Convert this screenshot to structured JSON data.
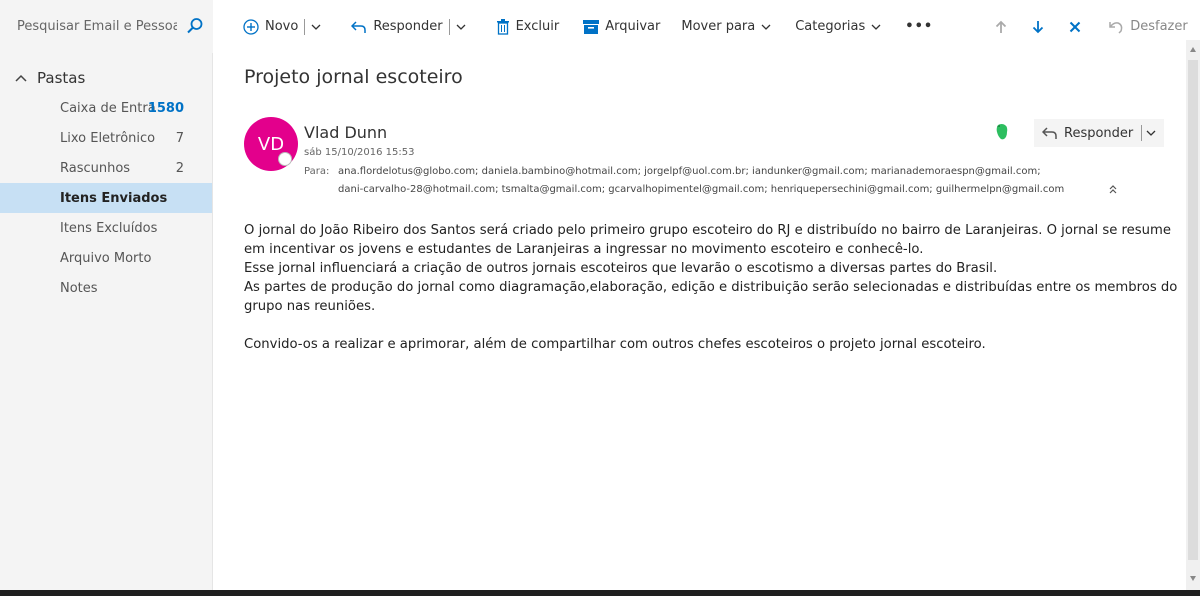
{
  "search": {
    "placeholder": "Pesquisar Email e Pessoas"
  },
  "toolbar": {
    "new_label": "Novo",
    "reply_label": "Responder",
    "delete_label": "Excluir",
    "archive_label": "Arquivar",
    "move_label": "Mover para",
    "categories_label": "Categorias",
    "more_label": "•••",
    "undo_label": "Desfazer"
  },
  "sidebar": {
    "header": "Pastas",
    "folders": [
      {
        "label": "Caixa de Entra",
        "count": "1580"
      },
      {
        "label": "Lixo Eletrônico",
        "count": "7"
      },
      {
        "label": "Rascunhos",
        "count": "2"
      },
      {
        "label": "Itens Enviados",
        "count": ""
      },
      {
        "label": "Itens Excluídos",
        "count": ""
      },
      {
        "label": "Arquivo Morto",
        "count": ""
      },
      {
        "label": "Notes",
        "count": ""
      }
    ]
  },
  "message": {
    "subject": "Projeto jornal escoteiro",
    "avatar_initials": "VD",
    "sender": "Vlad Dunn",
    "date": "sáb 15/10/2016 15:53",
    "to_label": "Para:",
    "to_line1": "ana.flordelotus@globo.com;  daniela.bambino@hotmail.com;  jorgelpf@uol.com.br;  iandunker@gmail.com;  marianademoraespn@gmail.com;",
    "to_line2": "dani-carvalho-28@hotmail.com;  tsmalta@gmail.com;  gcarvalhopimentel@gmail.com;  henriquepersechini@gmail.com;  guilhermelpn@gmail.com",
    "reply_button": "Responder",
    "body": [
      "O jornal do João Ribeiro dos Santos será criado pelo primeiro grupo escoteiro do RJ e distribuído no bairro de Laranjeiras. O jornal se resume",
      "em incentivar os jovens e estudantes de Laranjeiras a  ingressar no movimento escoteiro e conhecê-lo.",
      "Esse jornal influenciará a criação de outros jornais escoteiros que levarão o escotismo a diversas partes do Brasil.",
      "As partes de produção do jornal como diagramação,elaboração, edição e distribuição serão selecionadas e distribuídas entre os membros do",
      "grupo nas reuniões.",
      "Convido-os a realizar e aprimorar, além de compartilhar com outros chefes escoteiros o projeto jornal escoteiro."
    ]
  },
  "colors": {
    "accent": "#0072c6",
    "avatar": "#e3008c",
    "selected_folder": "#c7e0f4",
    "evernote": "#2dbe60"
  }
}
